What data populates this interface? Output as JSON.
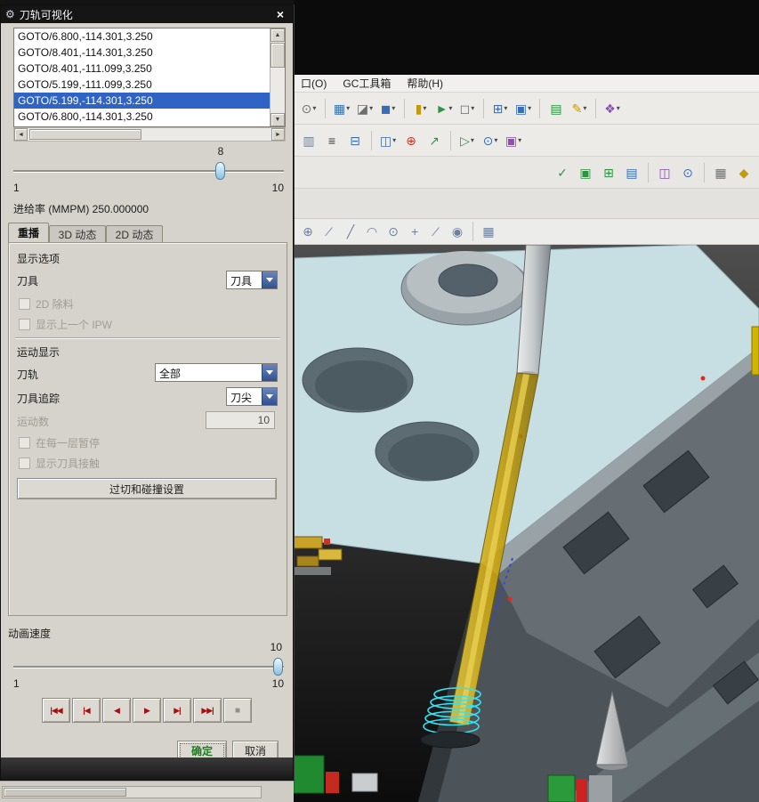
{
  "dialog": {
    "title": "刀轨可视化",
    "gear_glyph": "⚙",
    "close_glyph": "×",
    "goto_list": {
      "items": [
        "GOTO/6.800,-114.301,3.250",
        "GOTO/8.401,-114.301,3.250",
        "GOTO/8.401,-111.099,3.250",
        "GOTO/5.199,-111.099,3.250",
        "GOTO/5.199,-114.301,3.250",
        "GOTO/6.800,-114.301,3.250"
      ],
      "selected_index": 4
    },
    "scrollbar": {
      "up": "▲",
      "down": "▼",
      "left": "◄",
      "right": "►"
    },
    "progress": {
      "value": "8",
      "min": "1",
      "max": "10"
    },
    "feedrate": "进给率 (MMPM) 250.000000",
    "tabs": {
      "replay": "重播",
      "dyn3d": "3D 动态",
      "dyn2d": "2D 动态"
    },
    "display_options": {
      "title": "显示选项",
      "tool_label": "刀具",
      "tool_combo": "刀具",
      "chk_2d_material": "2D 除料",
      "chk_show_ipw": "显示上一个 IPW"
    },
    "motion": {
      "title": "运动显示",
      "path_label": "刀轨",
      "path_combo": "全部",
      "trace_label": "刀具追踪",
      "trace_combo": "刀尖",
      "count_label": "运动数",
      "count_value": "10",
      "chk_pause": "在每一层暂停",
      "chk_contact": "显示刀具接触"
    },
    "gouge_button": "过切和碰撞设置",
    "speed": {
      "title": "动画速度",
      "value": "10",
      "min": "1",
      "max": "10"
    },
    "playback": [
      {
        "name": "skip-to-start",
        "glyph": "|◀◀"
      },
      {
        "name": "step-to-start",
        "glyph": "|◀"
      },
      {
        "name": "play-backward",
        "glyph": "◀"
      },
      {
        "name": "play-forward",
        "glyph": "▶"
      },
      {
        "name": "step-forward",
        "glyph": "▶|"
      },
      {
        "name": "skip-to-end",
        "glyph": "▶▶|"
      },
      {
        "name": "stop",
        "glyph": "■"
      }
    ],
    "ok": "确定",
    "cancel": "取消"
  },
  "menubar": {
    "items": [
      "口(O)",
      "GC工具箱",
      "帮助(H)"
    ]
  },
  "toolbars": {
    "dd": "▾",
    "row1": [
      "⊙",
      "▦",
      "◪",
      "◼",
      "▮",
      "►",
      "◻",
      "⊞",
      "▣",
      "▤",
      "✎",
      "❖"
    ],
    "row2": [
      "▥",
      "≡",
      "⊟",
      "◫",
      "⊕",
      "↗",
      "▷",
      "⊙",
      "▣"
    ],
    "row3": [
      "✓",
      "▣",
      "⊞",
      "▤",
      "◫",
      "⊙",
      "▦",
      "◆"
    ],
    "sketch": [
      "⊕",
      "∕",
      "╱",
      "◠",
      "⊙",
      "+",
      "∕",
      "◉",
      "▦"
    ]
  },
  "statusbar": {
    "overflow_glyph": "»"
  },
  "colors": {
    "selection": "#2f63c4",
    "ok_text": "#1e7e1e",
    "playback_icon": "#a51010",
    "tool_yellow": "#c7a20d",
    "toolpath_cyan": "#35e2f2",
    "plate_blue": "#c7dee2"
  }
}
